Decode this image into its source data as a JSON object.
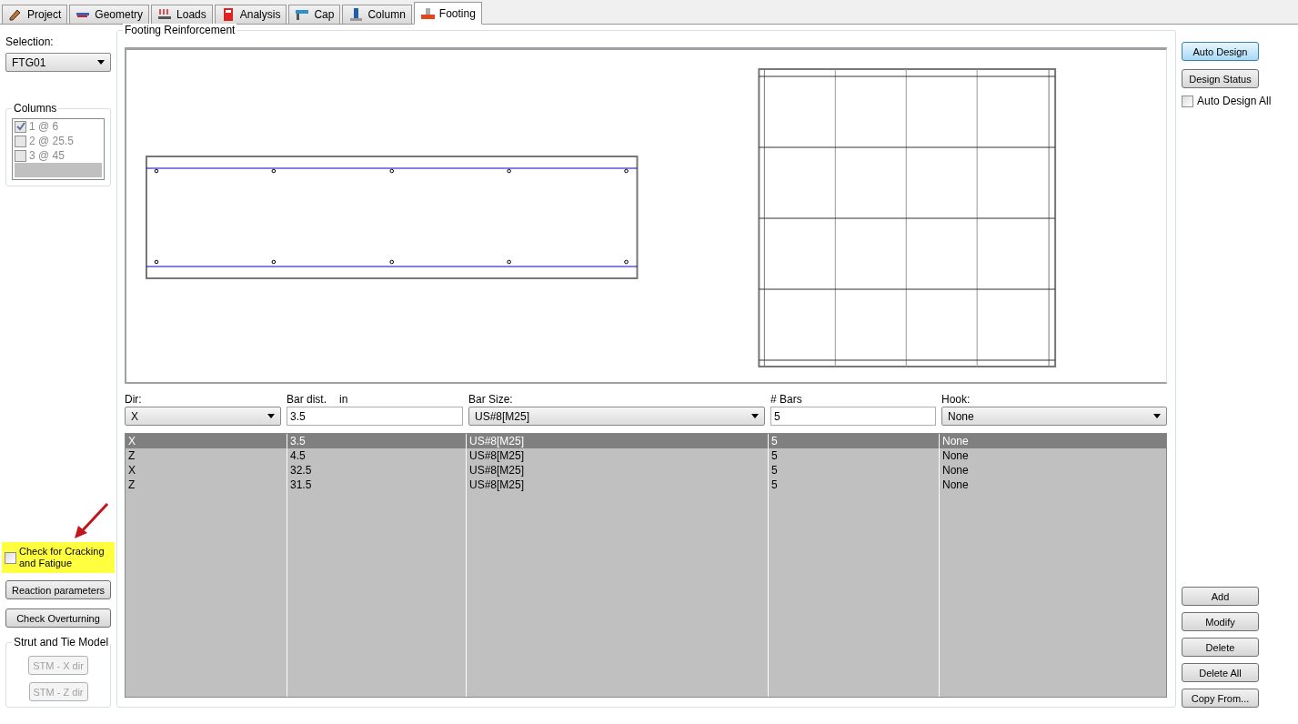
{
  "tabs": [
    {
      "label": "Project",
      "selected": false
    },
    {
      "label": "Geometry",
      "selected": false
    },
    {
      "label": "Loads",
      "selected": false
    },
    {
      "label": "Analysis",
      "selected": false
    },
    {
      "label": "Cap",
      "selected": false
    },
    {
      "label": "Column",
      "selected": false
    },
    {
      "label": "Footing",
      "selected": true
    }
  ],
  "left": {
    "selection_label": "Selection:",
    "selection_value": "FTG01",
    "columns": {
      "title": "Columns",
      "disabled": true,
      "items": [
        {
          "label": "1 @ 6",
          "checked": true
        },
        {
          "label": "2 @ 25.5",
          "checked": false
        },
        {
          "label": "3 @ 45",
          "checked": false
        }
      ]
    },
    "cracking": {
      "label": "Check for Cracking and Fatigue",
      "checked": false,
      "highlighted": true
    },
    "buttons": [
      "Reaction parameters",
      "Check Overturning"
    ],
    "stm": {
      "title": "Strut and Tie Model",
      "buttons": [
        {
          "label": "STM - X dir",
          "disabled": true
        },
        {
          "label": "STM - Z dir",
          "disabled": true
        }
      ]
    }
  },
  "main": {
    "title": "Footing Reinforcement",
    "fields": [
      {
        "kind": "select",
        "label": "Dir:",
        "value": "X"
      },
      {
        "kind": "input",
        "label": "Bar dist.",
        "unit": "in",
        "value": "3.5"
      },
      {
        "kind": "select",
        "label": "Bar Size:",
        "value": "US#8[M25]"
      },
      {
        "kind": "input",
        "label": "# Bars",
        "value": "5"
      },
      {
        "kind": "select",
        "label": "Hook:",
        "value": "None"
      }
    ],
    "rows": [
      {
        "cells": [
          "X",
          "3.5",
          "US#8[M25]",
          "5",
          "None"
        ],
        "selected": true
      },
      {
        "cells": [
          "Z",
          "4.5",
          "US#8[M25]",
          "5",
          "None"
        ],
        "selected": false
      },
      {
        "cells": [
          "X",
          "32.5",
          "US#8[M25]",
          "5",
          "None"
        ],
        "selected": false
      },
      {
        "cells": [
          "Z",
          "31.5",
          "US#8[M25]",
          "5",
          "None"
        ],
        "selected": false
      }
    ]
  },
  "right": {
    "top_buttons": [
      {
        "label": "Auto Design",
        "focused": true
      },
      {
        "label": "Design Status",
        "focused": false
      }
    ],
    "auto_all": {
      "label": "Auto Design All",
      "checked": false
    },
    "bottom_buttons": [
      "Add",
      "Modify",
      "Delete",
      "Delete All",
      "Copy From..."
    ]
  }
}
